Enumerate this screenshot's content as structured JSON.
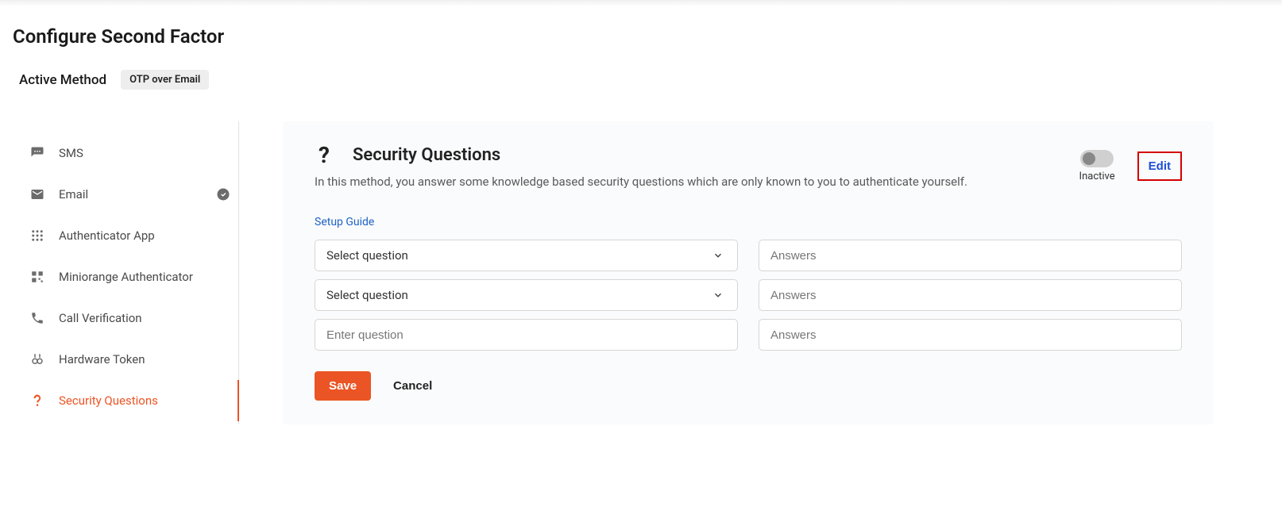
{
  "header": {
    "title": "Configure Second Factor",
    "active_method_label": "Active Method",
    "active_method_value": "OTP over Email"
  },
  "sidebar": {
    "items": [
      {
        "label": "SMS",
        "active": false,
        "checked": false
      },
      {
        "label": "Email",
        "active": false,
        "checked": true
      },
      {
        "label": "Authenticator App",
        "active": false,
        "checked": false
      },
      {
        "label": "Miniorange Authenticator",
        "active": false,
        "checked": false
      },
      {
        "label": "Call Verification",
        "active": false,
        "checked": false
      },
      {
        "label": "Hardware Token",
        "active": false,
        "checked": false
      },
      {
        "label": "Security Questions",
        "active": true,
        "checked": false
      }
    ]
  },
  "panel": {
    "title": "Security Questions",
    "description": "In this method, you answer some knowledge based security questions which are only known to you to authenticate yourself.",
    "toggle_state_label": "Inactive",
    "edit_label": "Edit",
    "setup_guide_label": "Setup Guide",
    "select_placeholder": "Select question",
    "custom_question_placeholder": "Enter question",
    "answer_placeholder": "Answers",
    "save_label": "Save",
    "cancel_label": "Cancel"
  }
}
